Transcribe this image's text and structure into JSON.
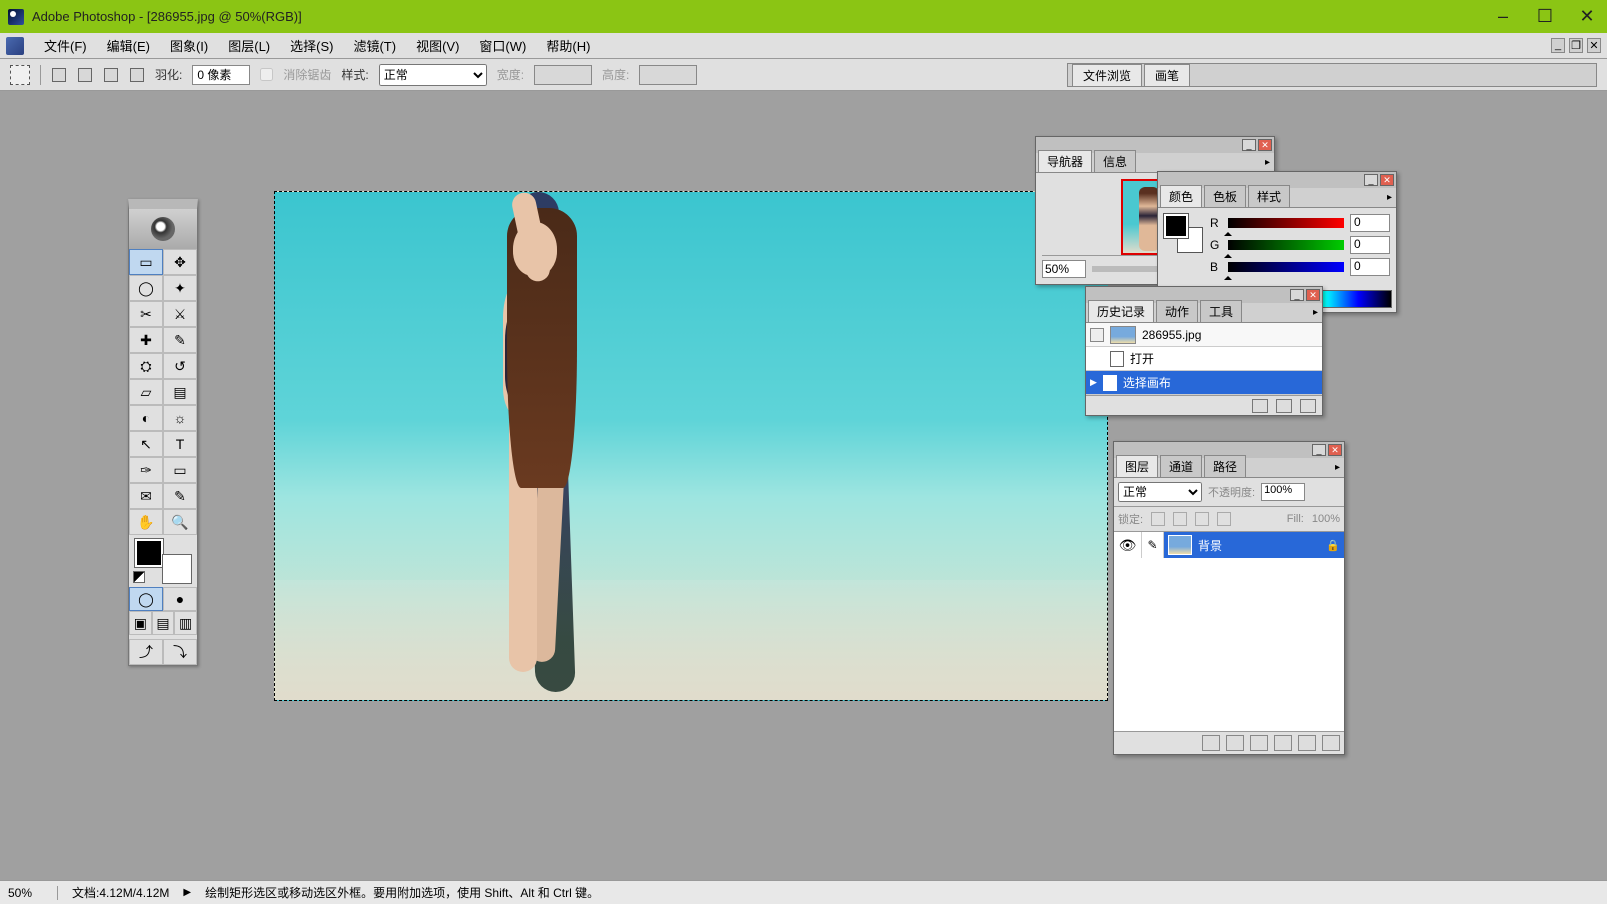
{
  "window": {
    "title": "Adobe Photoshop - [286955.jpg @ 50%(RGB)]"
  },
  "menu": {
    "items": [
      "文件(F)",
      "编辑(E)",
      "图象(I)",
      "图层(L)",
      "选择(S)",
      "滤镜(T)",
      "视图(V)",
      "窗口(W)",
      "帮助(H)"
    ]
  },
  "options": {
    "feather_label": "羽化:",
    "feather_value": "0 像素",
    "antialias_label": "消除锯齿",
    "style_label": "样式:",
    "style_value": "正常",
    "width_label": "宽度:",
    "height_label": "高度:"
  },
  "palette_well": {
    "tabs": [
      "文件浏览",
      "画笔"
    ]
  },
  "toolbox": {
    "tools": [
      {
        "name": "marquee",
        "glyph": "▭",
        "active": true
      },
      {
        "name": "move",
        "glyph": "✥"
      },
      {
        "name": "lasso",
        "glyph": "◯"
      },
      {
        "name": "wand",
        "glyph": "✦"
      },
      {
        "name": "crop",
        "glyph": "✂"
      },
      {
        "name": "slice",
        "glyph": "⚔"
      },
      {
        "name": "heal",
        "glyph": "✚"
      },
      {
        "name": "brush",
        "glyph": "✎"
      },
      {
        "name": "stamp",
        "glyph": "⛭"
      },
      {
        "name": "history-brush",
        "glyph": "↺"
      },
      {
        "name": "eraser",
        "glyph": "▱"
      },
      {
        "name": "gradient",
        "glyph": "▤"
      },
      {
        "name": "blur",
        "glyph": "◐"
      },
      {
        "name": "dodge",
        "glyph": "☼"
      },
      {
        "name": "path",
        "glyph": "↖"
      },
      {
        "name": "type",
        "glyph": "T"
      },
      {
        "name": "pen",
        "glyph": "✑"
      },
      {
        "name": "shape",
        "glyph": "▭"
      },
      {
        "name": "notes",
        "glyph": "✉"
      },
      {
        "name": "eyedrop",
        "glyph": "✎"
      },
      {
        "name": "hand",
        "glyph": "✋"
      },
      {
        "name": "zoom",
        "glyph": "🔍"
      }
    ]
  },
  "navigator": {
    "tabs": [
      "导航器",
      "信息"
    ],
    "zoom": "50%"
  },
  "color": {
    "tabs": [
      "颜色",
      "色板",
      "样式"
    ],
    "r_label": "R",
    "r_value": "0",
    "g_label": "G",
    "g_value": "0",
    "b_label": "B",
    "b_value": "0"
  },
  "history": {
    "tabs": [
      "历史记录",
      "动作",
      "工具"
    ],
    "document": "286955.jpg",
    "states": [
      "打开",
      "选择画布"
    ],
    "selected_index": 1
  },
  "layers": {
    "tabs": [
      "图层",
      "通道",
      "路径"
    ],
    "blend_mode": "正常",
    "opacity_label": "不透明度:",
    "opacity_value": "100%",
    "lock_label": "锁定:",
    "fill_label": "Fill:",
    "fill_value": "100%",
    "items": [
      {
        "name": "背景",
        "locked": true
      }
    ]
  },
  "status": {
    "zoom": "50%",
    "doc_info": "文档:4.12M/4.12M",
    "hint": "绘制矩形选区或移动选区外框。要用附加选项，使用 Shift、Alt 和 Ctrl 键。"
  }
}
